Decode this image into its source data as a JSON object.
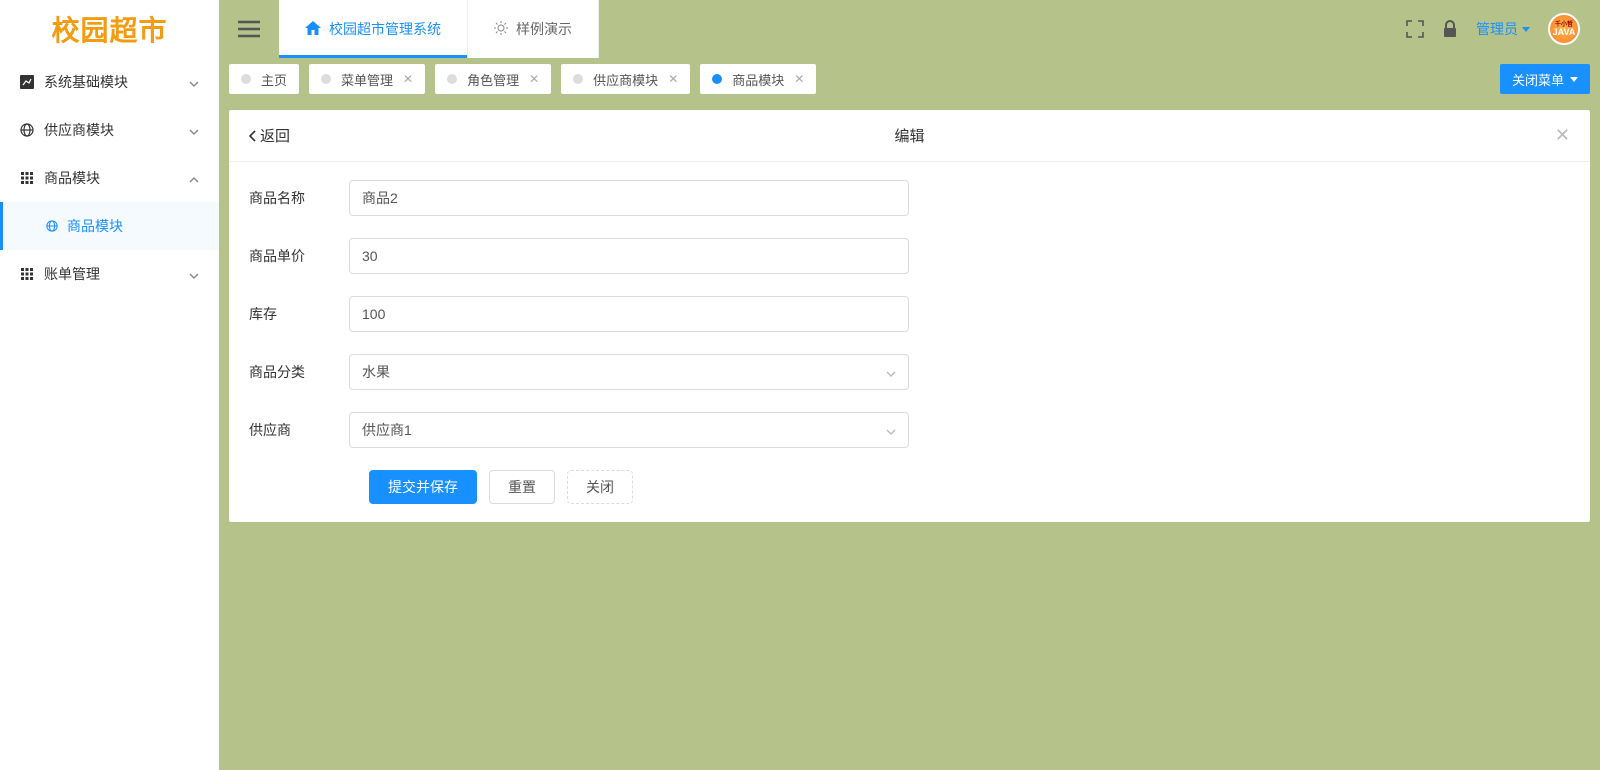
{
  "logo": "校园超市",
  "header": {
    "tabs": [
      {
        "label": "校园超市管理系统",
        "active": true
      },
      {
        "label": "样例演示",
        "active": false
      }
    ],
    "user": "管理员",
    "avatar": "JAVA",
    "avatar_sub": "千小哲"
  },
  "sidebar": {
    "items": [
      {
        "label": "系统基础模块",
        "icon": "dashboard",
        "expand": "down"
      },
      {
        "label": "供应商模块",
        "icon": "globe",
        "expand": "down"
      },
      {
        "label": "商品模块",
        "icon": "grid",
        "expand": "up"
      },
      {
        "label": "账单管理",
        "icon": "grid",
        "expand": "down"
      }
    ],
    "sub": {
      "label": "商品模块"
    }
  },
  "tabs": [
    {
      "label": "主页",
      "closable": false,
      "active": false
    },
    {
      "label": "菜单管理",
      "closable": true,
      "active": false
    },
    {
      "label": "角色管理",
      "closable": true,
      "active": false
    },
    {
      "label": "供应商模块",
      "closable": true,
      "active": false
    },
    {
      "label": "商品模块",
      "closable": true,
      "active": true
    }
  ],
  "close_menu": "关闭菜单",
  "panel": {
    "back": "返回",
    "title": "编辑"
  },
  "form": {
    "name_label": "商品名称",
    "name_value": "商品2",
    "price_label": "商品单价",
    "price_value": "30",
    "stock_label": "库存",
    "stock_value": "100",
    "category_label": "商品分类",
    "category_value": "水果",
    "supplier_label": "供应商",
    "supplier_value": "供应商1",
    "submit": "提交并保存",
    "reset": "重置",
    "close": "关闭"
  }
}
